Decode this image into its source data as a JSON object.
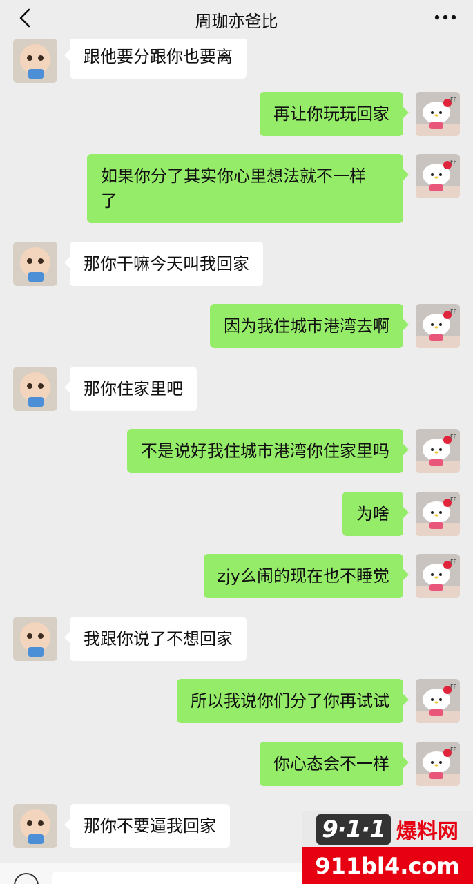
{
  "header": {
    "title": "周珈亦爸比",
    "back_icon": "chevron-left-icon",
    "more_icon": "more-horizontal-icon"
  },
  "colors": {
    "background": "#ededed",
    "sent_bubble": "#95ec69",
    "received_bubble": "#ffffff",
    "watermark_red": "#e60012"
  },
  "avatars": {
    "contact": "baby-photo-avatar",
    "self": "hello-kitty-avatar"
  },
  "messages": [
    {
      "side": "left",
      "text": "跟他要分跟你也要离"
    },
    {
      "side": "right",
      "text": "再让你玩玩回家"
    },
    {
      "side": "right",
      "text": "如果你分了其实你心里想法就不一样\n了"
    },
    {
      "side": "left",
      "text": "那你干嘛今天叫我回家"
    },
    {
      "side": "right",
      "text": "因为我住城市港湾去啊"
    },
    {
      "side": "left",
      "text": "那你住家里吧"
    },
    {
      "side": "right",
      "text": "不是说好我住城市港湾你住家里吗"
    },
    {
      "side": "right",
      "text": "为啥"
    },
    {
      "side": "right",
      "text": "zjy么闹的现在也不睡觉"
    },
    {
      "side": "left",
      "text": "我跟你说了不想回家"
    },
    {
      "side": "right",
      "text": "所以我说你们分了你再试试"
    },
    {
      "side": "right",
      "text": "你心态会不一样"
    },
    {
      "side": "left",
      "text": "那你不要逼我回家"
    }
  ],
  "watermark": {
    "logo": "9·1·1",
    "title": "爆料网",
    "url": "911bl4.com"
  }
}
